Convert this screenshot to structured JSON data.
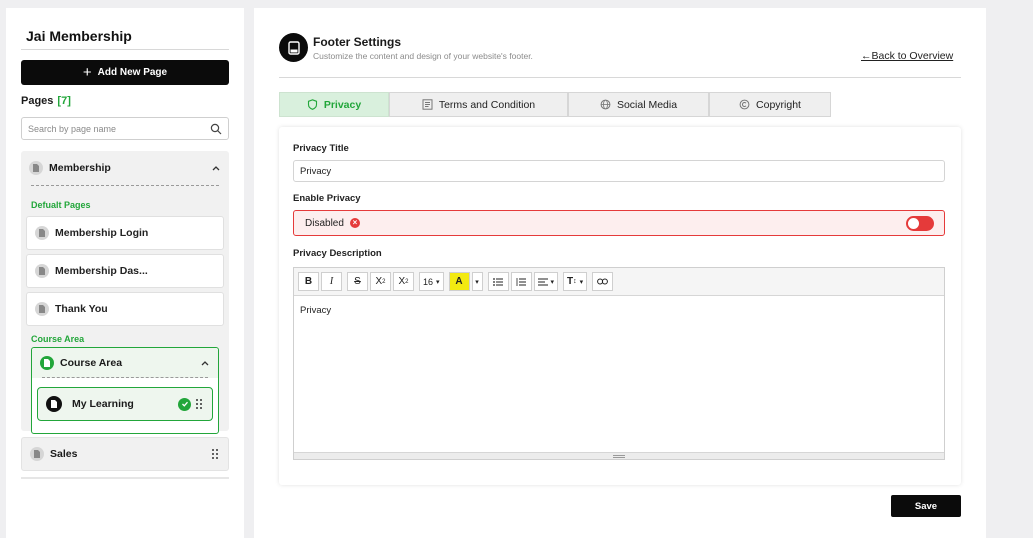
{
  "sidebar": {
    "site_name": "Jai Membership",
    "add_button": "Add New Page",
    "pages_label": "Pages",
    "pages_count": "[7]",
    "search_placeholder": "Search by page name",
    "membership_group": {
      "label": "Membership",
      "default_pages_label": "Defualt Pages",
      "default_pages": [
        "Membership Login",
        "Membership Das...",
        "Thank You"
      ],
      "course_area_label": "Course Area",
      "course_area": {
        "label": "Course Area",
        "items": [
          "My Learning"
        ]
      }
    },
    "sales_group": {
      "label": "Sales"
    }
  },
  "main": {
    "title": "Footer Settings",
    "subtitle": "Customize the content and design of your website's footer.",
    "back_link": "Back to Overview",
    "tabs": [
      {
        "label": "Privacy",
        "active": true
      },
      {
        "label": "Terms and Condition",
        "active": false
      },
      {
        "label": "Social Media",
        "active": false
      },
      {
        "label": "Copyright",
        "active": false
      }
    ],
    "privacy_title_label": "Privacy Title",
    "privacy_title_value": "Privacy",
    "enable_privacy_label": "Enable Privacy",
    "enable_privacy_status": "Disabled",
    "privacy_description_label": "Privacy Description",
    "editor": {
      "font_size": "16",
      "content": "Privacy"
    },
    "save_button": "Save"
  },
  "colors": {
    "accent_green": "#22a63a",
    "danger_red": "#e53a3a",
    "primary_black": "#0b0b0b"
  }
}
